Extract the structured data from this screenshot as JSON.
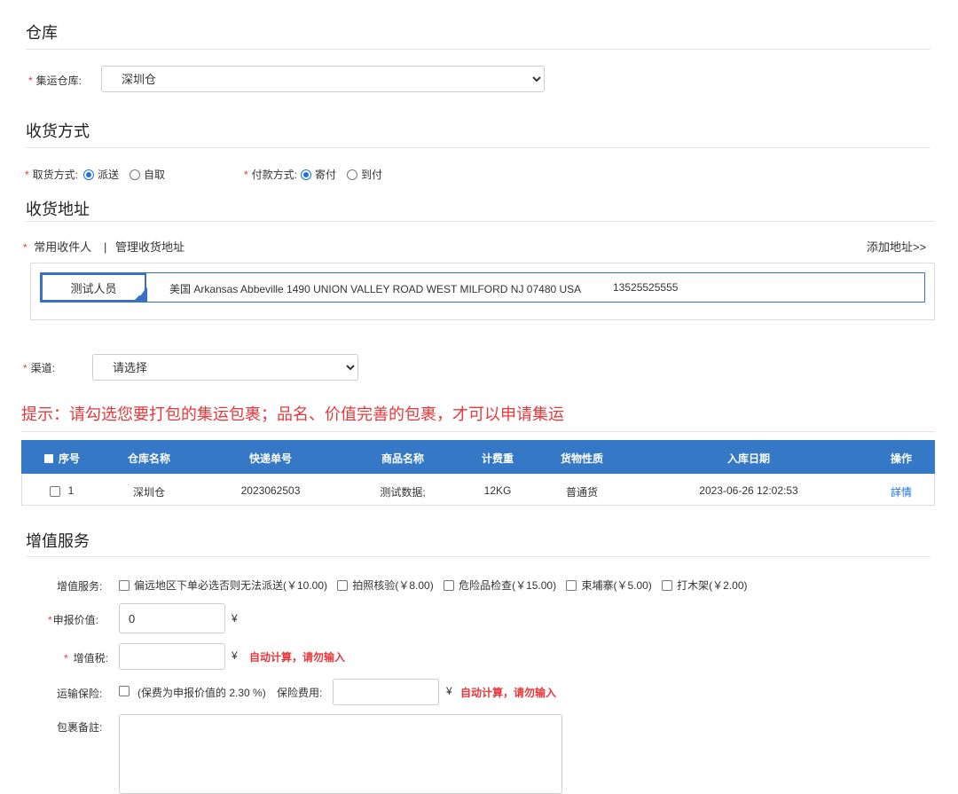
{
  "warehouse_section": {
    "title": "仓库",
    "label": "集运仓库:",
    "selected": "深圳仓"
  },
  "receive_method_section": {
    "title": "收货方式",
    "pickup_label": "取货方式:",
    "pickup_options": [
      "派送",
      "自取"
    ],
    "payment_label": "付款方式:",
    "payment_options": [
      "寄付",
      "到付"
    ]
  },
  "address_section": {
    "title": "收货地址",
    "common_recipients": "常用收件人",
    "separator": "|",
    "manage_address": "管理收货地址",
    "add_address": "添加地址>>",
    "address_name": "测试人员",
    "address_detail": "美国 Arkansas Abbeville 1490 UNION VALLEY ROAD WEST MILFORD NJ 07480 USA",
    "address_phone": "13525525555"
  },
  "channel": {
    "label": "渠道:",
    "selected": "请选择"
  },
  "tip": "提示：请勾选您要打包的集运包裹；品名、价值完善的包裹，才可以申请集运",
  "table": {
    "headers": [
      "序号",
      "仓库名称",
      "快递单号",
      "商品名称",
      "计费重",
      "货物性质",
      "入库日期",
      "操作"
    ],
    "rows": [
      {
        "index": "1",
        "warehouse": "深圳仓",
        "tracking": "2023062503",
        "product": "测试数据;",
        "weight": "12KG",
        "nature": "普通货",
        "date": "2023-06-26 12:02:53",
        "action": "詳情"
      }
    ]
  },
  "value_added_section": {
    "title": "增值服务",
    "services_label": "增值服务:",
    "services": [
      "偏远地区下单必选否则无法派送(￥10.00)",
      "拍照核验(￥8.00)",
      "危险品检查(￥15.00)",
      "束埔寨(￥5.00)",
      "打木架(￥2.00)"
    ],
    "declared_label": "申报价值:",
    "declared_value": "0",
    "currency": "¥",
    "vat_label": "增值税:",
    "auto_calc_note": "自动计算，请勿输入",
    "insurance_label": "运输保险:",
    "insurance_desc": "(保费为申报价值的 2.30 %)",
    "insurance_fee_label": "保险费用:",
    "remark_label": "包裹备註:"
  },
  "colors": {
    "accent": "#3478c6",
    "required": "#e4393c",
    "link": "#1a73e8"
  }
}
